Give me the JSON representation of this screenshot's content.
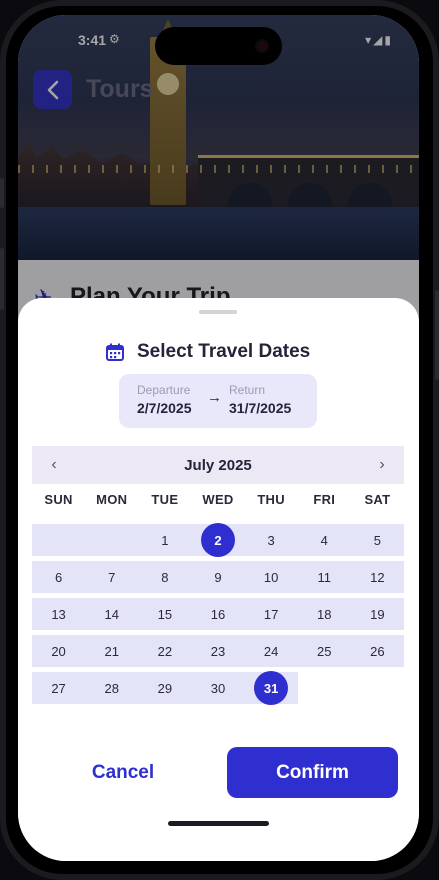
{
  "status_bar": {
    "time": "3:41",
    "right_icons": "▾◢▮"
  },
  "background": {
    "brand": "Tours",
    "heading": "Plan Your Trip"
  },
  "sheet": {
    "title": "Select Travel Dates",
    "departure_label": "Departure",
    "departure_value": "2/7/2025",
    "return_label": "Return",
    "return_value": "31/7/2025"
  },
  "calendar": {
    "month_label": "July 2025",
    "weekdays": [
      "SUN",
      "MON",
      "TUE",
      "WED",
      "THU",
      "FRI",
      "SAT"
    ],
    "leading_blanks": 2,
    "days": [
      "1",
      "2",
      "3",
      "4",
      "5",
      "6",
      "7",
      "8",
      "9",
      "10",
      "11",
      "12",
      "13",
      "14",
      "15",
      "16",
      "17",
      "18",
      "19",
      "20",
      "21",
      "22",
      "23",
      "24",
      "25",
      "26",
      "27",
      "28",
      "29",
      "30",
      "31"
    ],
    "selected_start": "2",
    "selected_end": "31"
  },
  "buttons": {
    "cancel": "Cancel",
    "confirm": "Confirm"
  },
  "colors": {
    "accent": "#2f2fd0",
    "range_fill": "#e4e4f8",
    "header_fill": "#ece8f5"
  },
  "icons": {
    "back": "chevron-left-icon",
    "calendar": "calendar-icon",
    "arrow": "arrow-right-icon",
    "plane": "plane-icon"
  }
}
